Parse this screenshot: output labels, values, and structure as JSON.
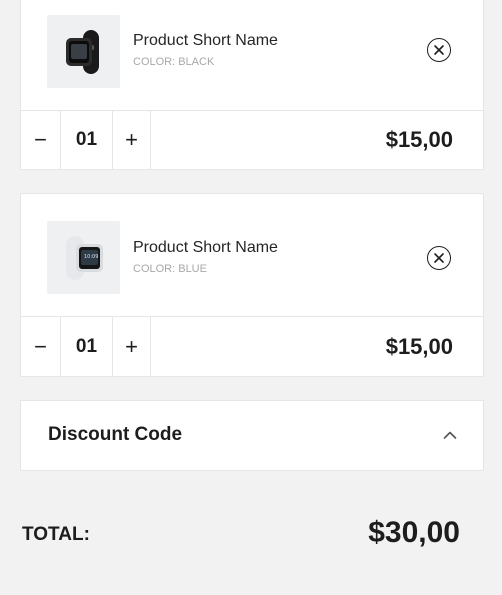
{
  "cart": {
    "items": [
      {
        "name": "Product Short Name",
        "color_label": "COLOR: BLACK",
        "quantity": "01",
        "price": "$15,00",
        "minus_symbol": "−",
        "plus_symbol": "+",
        "thumbnail_icon": "black-smartwatch-image",
        "remove_icon": "close-circle-icon"
      },
      {
        "name": "Product Short Name",
        "color_label": "COLOR: BLUE",
        "quantity": "01",
        "price": "$15,00",
        "minus_symbol": "−",
        "plus_symbol": "+",
        "thumbnail_icon": "white-smartwatch-image",
        "remove_icon": "close-circle-icon"
      }
    ]
  },
  "discount": {
    "label": "Discount Code",
    "icon": "chevron-up-icon"
  },
  "total": {
    "label": "TOTAL:",
    "value": "$30,00"
  },
  "colors": {
    "background": "#f2f2f2",
    "card": "#ffffff",
    "text": "#1d1d1d",
    "muted": "#a8a8a8",
    "border": "#e6e6e6"
  }
}
